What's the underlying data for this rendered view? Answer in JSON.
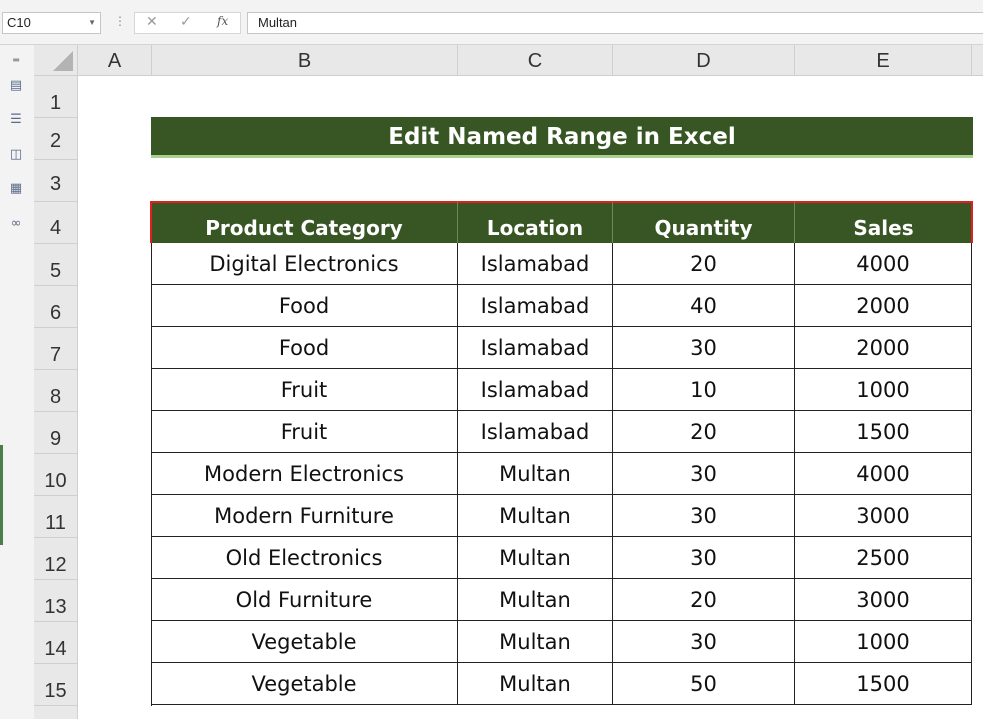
{
  "formula_bar": {
    "name_box": "C10",
    "cancel_symbol": "✕",
    "enter_symbol": "✓",
    "fx_symbol": "fx",
    "formula": "Multan"
  },
  "side_toolbar": {
    "icons": [
      "table-icon",
      "list-icon",
      "stack-icon",
      "grid-icon",
      "binoculars-icon"
    ]
  },
  "columns": [
    "A",
    "B",
    "C",
    "D",
    "E"
  ],
  "rows": [
    "1",
    "2",
    "3",
    "4",
    "5",
    "6",
    "7",
    "8",
    "9",
    "10",
    "11",
    "12",
    "13",
    "14",
    "15"
  ],
  "title": "Edit Named Range in Excel",
  "table": {
    "headers": [
      "Product Category",
      "Location",
      "Quantity",
      "Sales"
    ],
    "rows": [
      [
        "Digital Electronics",
        "Islamabad",
        "20",
        "4000"
      ],
      [
        "Food",
        "Islamabad",
        "40",
        "2000"
      ],
      [
        "Food",
        "Islamabad",
        "30",
        "2000"
      ],
      [
        "Fruit",
        "Islamabad",
        "10",
        "1000"
      ],
      [
        "Fruit",
        "Islamabad",
        "20",
        "1500"
      ],
      [
        "Modern Electronics",
        "Multan",
        "30",
        "4000"
      ],
      [
        "Modern Furniture",
        "Multan",
        "30",
        "3000"
      ],
      [
        "Old Electronics",
        "Multan",
        "30",
        "2500"
      ],
      [
        "Old Furniture",
        "Multan",
        "20",
        "3000"
      ],
      [
        "Vegetable",
        "Multan",
        "30",
        "1000"
      ],
      [
        "Vegetable",
        "Multan",
        "50",
        "1500"
      ]
    ]
  },
  "colors": {
    "header_green": "#375623",
    "title_underline": "#a9d08e",
    "selection_red": "#e02020"
  }
}
